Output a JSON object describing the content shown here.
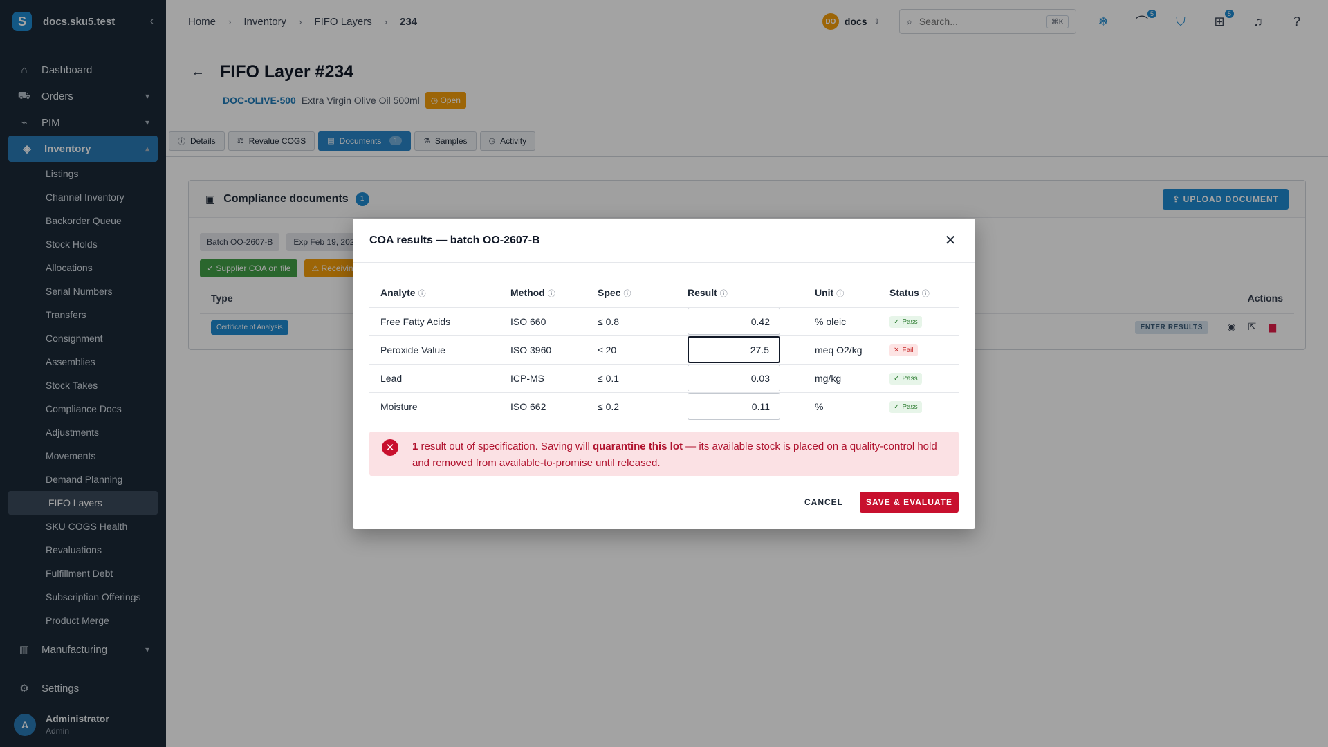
{
  "sidebar": {
    "brand_letter": "S",
    "brand_name": "docs.sku5.test",
    "items": [
      {
        "label": "Dashboard"
      },
      {
        "label": "Orders"
      },
      {
        "label": "PIM"
      },
      {
        "label": "Inventory"
      }
    ],
    "inventory_sub": [
      "Listings",
      "Channel Inventory",
      "Backorder Queue",
      "Stock Holds",
      "Allocations",
      "Serial Numbers",
      "Transfers",
      "Consignment",
      "Assemblies",
      "Stock Takes",
      "Compliance Docs",
      "Adjustments",
      "Movements",
      "Demand Planning",
      "FIFO Layers",
      "SKU COGS Health",
      "Revaluations",
      "Fulfillment Debt",
      "Subscription Offerings",
      "Product Merge"
    ],
    "manufacturing": "Manufacturing",
    "settings": "Settings",
    "user": {
      "initial": "A",
      "name": "Administrator",
      "role": "Admin"
    }
  },
  "topbar": {
    "breadcrumbs": [
      "Home",
      "Inventory",
      "FIFO Layers",
      "234"
    ],
    "org_initials": "DO",
    "org_name": "docs",
    "search_placeholder": "Search...",
    "search_shortcut": "⌘K",
    "badge_a": "5",
    "badge_b": "5"
  },
  "page": {
    "title": "FIFO Layer #234",
    "sku": "DOC-OLIVE-500",
    "product": "Extra Virgin Olive Oil 500ml",
    "status": "Open",
    "tabs": [
      {
        "label": "Details"
      },
      {
        "label": "Revalue COGS"
      },
      {
        "label": "Documents",
        "count": "1"
      },
      {
        "label": "Samples"
      },
      {
        "label": "Activity"
      }
    ]
  },
  "card": {
    "title": "Compliance documents",
    "count": "1",
    "upload": "UPLOAD DOCUMENT",
    "chip_batch": "Batch OO-2607-B",
    "chip_exp": "Exp Feb 19, 202",
    "chip_supplier": "Supplier COA on file",
    "chip_receiving": "Receiving",
    "col_type": "Type",
    "col_actions": "Actions",
    "row_type": "Certificate of Analysis",
    "enter_results": "ENTER RESULTS"
  },
  "modal": {
    "title": "COA results — batch OO-2607-B",
    "headers": [
      "Analyte",
      "Method",
      "Spec",
      "Result",
      "Unit",
      "Status"
    ],
    "rows": [
      {
        "analyte": "Free Fatty Acids",
        "method": "ISO 660",
        "spec": "≤ 0.8",
        "result": "0.42",
        "unit": "% oleic",
        "status": "Pass"
      },
      {
        "analyte": "Peroxide Value",
        "method": "ISO 3960",
        "spec": "≤ 20",
        "result": "27.5",
        "unit": "meq O2/kg",
        "status": "Fail"
      },
      {
        "analyte": "Lead",
        "method": "ICP-MS",
        "spec": "≤ 0.1",
        "result": "0.03",
        "unit": "mg/kg",
        "status": "Pass"
      },
      {
        "analyte": "Moisture",
        "method": "ISO 662",
        "spec": "≤ 0.2",
        "result": "0.11",
        "unit": "%",
        "status": "Pass"
      }
    ],
    "alert": {
      "count": "1",
      "part1": " result out of specification. Saving will ",
      "strong": "quarantine this lot",
      "part2": " — its available stock is placed on a quality-control hold and removed from available-to-promise until released."
    },
    "cancel": "CANCEL",
    "save": "SAVE & EVALUATE"
  }
}
